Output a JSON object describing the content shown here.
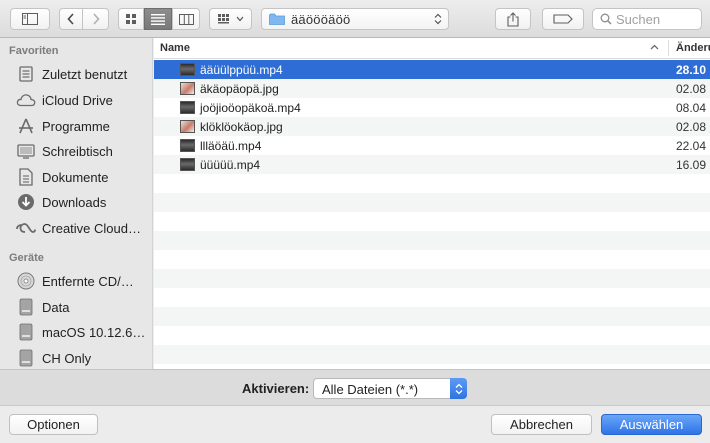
{
  "toolbar": {
    "path_label": "ääöööäöö",
    "search_placeholder": "Suchen"
  },
  "sidebar": {
    "favorites_header": "Favoriten",
    "favorites": [
      {
        "label": "Zuletzt benutzt",
        "icon": "recents-icon"
      },
      {
        "label": "iCloud Drive",
        "icon": "cloud-icon"
      },
      {
        "label": "Programme",
        "icon": "applications-icon"
      },
      {
        "label": "Schreibtisch",
        "icon": "desktop-icon"
      },
      {
        "label": "Dokumente",
        "icon": "documents-icon"
      },
      {
        "label": "Downloads",
        "icon": "downloads-icon"
      },
      {
        "label": "Creative Cloud…",
        "icon": "creative-cloud-icon"
      }
    ],
    "devices_header": "Geräte",
    "devices": [
      {
        "label": "Entfernte CD/…",
        "icon": "optical-disc-icon"
      },
      {
        "label": "Data",
        "icon": "drive-icon"
      },
      {
        "label": "macOS 10.12.6…",
        "icon": "drive-icon"
      },
      {
        "label": "CH Only",
        "icon": "drive-icon"
      }
    ]
  },
  "filelist": {
    "col_name": "Name",
    "col_date": "Änderungsdatum",
    "files": [
      {
        "name": "ääüülppüü.mp4",
        "date": "28.10",
        "type": "video",
        "selected": true
      },
      {
        "name": "äkäopäopä.jpg",
        "date": "02.08",
        "type": "image",
        "selected": false
      },
      {
        "name": "joöjioöopäkoä.mp4",
        "date": "08.04",
        "type": "video",
        "selected": false
      },
      {
        "name": "klöklöokäop.jpg",
        "date": "02.08",
        "type": "image",
        "selected": false
      },
      {
        "name": "llläöäü.mp4",
        "date": "22.04",
        "type": "video",
        "selected": false
      },
      {
        "name": "üüüüü.mp4",
        "date": "16.09",
        "type": "video",
        "selected": false
      }
    ]
  },
  "accessory": {
    "label": "Aktivieren:",
    "format_value": "Alle Dateien (*.*)"
  },
  "buttons": {
    "options": "Optionen",
    "cancel": "Abbrechen",
    "choose": "Auswählen"
  },
  "colors": {
    "selection": "#2e6dd6",
    "primary_button": "#2d74e6"
  }
}
